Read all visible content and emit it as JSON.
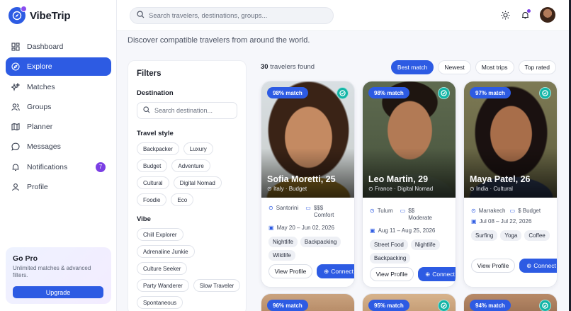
{
  "app": {
    "name": "VibeTrip"
  },
  "topbar": {
    "search_placeholder": "Search travelers, destinations, groups..."
  },
  "sidebar": {
    "items": [
      {
        "label": "Dashboard",
        "icon": "dashboard-icon"
      },
      {
        "label": "Explore",
        "icon": "compass-icon",
        "active": true
      },
      {
        "label": "Matches",
        "icon": "sparkles-icon"
      },
      {
        "label": "Groups",
        "icon": "users-icon"
      },
      {
        "label": "Planner",
        "icon": "map-icon"
      },
      {
        "label": "Messages",
        "icon": "chat-icon"
      },
      {
        "label": "Notifications",
        "icon": "bell-icon",
        "badge": "7"
      },
      {
        "label": "Profile",
        "icon": "user-icon"
      }
    ],
    "gopro": {
      "title": "Go Pro",
      "text": "Unlimited matches & advanced filters.",
      "button": "Upgrade"
    }
  },
  "main": {
    "subtitle": "Discover compatible travelers from around the world.",
    "count_number": "30",
    "count_label": "travelers found",
    "sorts": [
      "Best match",
      "Newest",
      "Most trips",
      "Top rated"
    ]
  },
  "filters": {
    "title": "Filters",
    "destination_label": "Destination",
    "destination_placeholder": "Search destination...",
    "travel_style_label": "Travel style",
    "travel_styles": [
      "Backpacker",
      "Luxury",
      "Budget",
      "Adventure",
      "Cultural",
      "Digital Nomad",
      "Foodie",
      "Eco"
    ],
    "vibe_label": "Vibe",
    "vibes": [
      "Chill Explorer",
      "Adrenaline Junkie",
      "Culture Seeker",
      "Party Wanderer",
      "Slow Traveler",
      "Spontaneous"
    ]
  },
  "cards": [
    {
      "match": "98% match",
      "name": "Sofia Moretti, 25",
      "location": "Italy · Budget",
      "destination": "Santorini",
      "budget": "$$$ Comfort",
      "dates": "May 20 – Jun 02, 2026",
      "tags": [
        "Nightlife",
        "Backpacking",
        "Wildlife"
      ],
      "view": "View Profile",
      "connect": "Connect"
    },
    {
      "match": "98% match",
      "name": "Leo Martin, 29",
      "location": "France · Digital Nomad",
      "destination": "Tulum",
      "budget": "$$ Moderate",
      "dates": "Aug 11 – Aug 25, 2026",
      "tags": [
        "Street Food",
        "Nightlife",
        "Backpacking"
      ],
      "view": "View Profile",
      "connect": "Connect"
    },
    {
      "match": "97% match",
      "name": "Maya Patel, 26",
      "location": "India · Cultural",
      "destination": "Marrakech",
      "budget": "$ Budget",
      "dates": "Jul 08 – Jul 22, 2026",
      "tags": [
        "Surfing",
        "Yoga",
        "Coffee"
      ],
      "view": "View Profile",
      "connect": "Connect"
    }
  ],
  "peek_cards": [
    {
      "match": "96% match"
    },
    {
      "match": "95% match"
    },
    {
      "match": "94% match"
    }
  ],
  "colors": {
    "accent": "#2d5be3",
    "badge": "#7b3fe4",
    "verified": "#12b5a6"
  }
}
